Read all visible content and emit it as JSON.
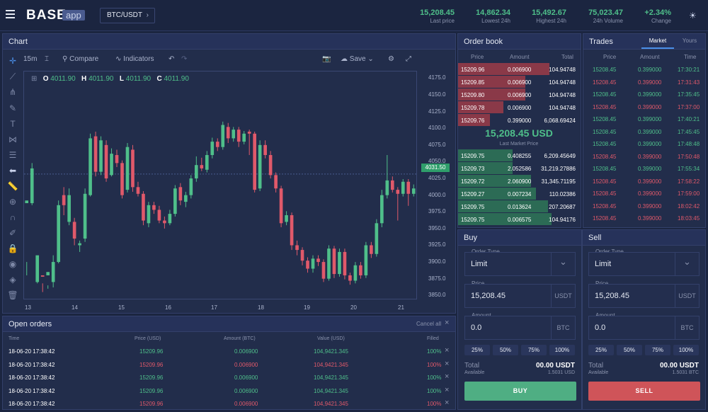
{
  "header": {
    "logo": "BASE",
    "logo_sub": "app",
    "pair": "BTC/USDT",
    "stats": [
      {
        "value": "15,208.45",
        "label": "Last price"
      },
      {
        "value": "14,862.34",
        "label": "Lowest 24h"
      },
      {
        "value": "15,492.67",
        "label": "Highest 24h"
      },
      {
        "value": "75,023.47",
        "label": "24h Volume"
      },
      {
        "value": "+2.34%",
        "label": "Change"
      }
    ]
  },
  "chart": {
    "title": "Chart",
    "interval": "15m",
    "compare": "Compare",
    "indicators": "Indicators",
    "save": "Save",
    "ohlc": {
      "o_label": "O",
      "o": "4011.90",
      "h_label": "H",
      "h": "4011.90",
      "l_label": "L",
      "l": "4011.90",
      "c_label": "C",
      "c": "4011.90"
    },
    "price_tag": "4031.50",
    "y_ticks": [
      "4175.0",
      "4150.0",
      "4125.0",
      "4100.0",
      "4075.0",
      "4050.0",
      "4025.0",
      "4000.0",
      "3975.0",
      "3950.0",
      "3925.0",
      "3900.0",
      "3875.0",
      "3850.0"
    ],
    "x_ticks": [
      "13",
      "14",
      "15",
      "16",
      "17",
      "18",
      "19",
      "20",
      "21"
    ]
  },
  "chart_data": {
    "type": "candlestick",
    "ylim": [
      3845,
      4185
    ],
    "last": 4031.5,
    "candles": [
      [
        3988,
        3992,
        3900,
        3880
      ],
      [
        3988,
        4040,
        3985,
        4048
      ],
      [
        3870,
        3910,
        3868,
        3872
      ],
      [
        3880,
        3878,
        3855,
        3868
      ],
      [
        3880,
        3885,
        3860,
        3865
      ],
      [
        3870,
        3900,
        3862,
        3910
      ],
      [
        3900,
        3985,
        3898,
        3992
      ],
      [
        4000,
        3985,
        3970,
        4012
      ],
      [
        3960,
        4000,
        3955,
        4010
      ],
      [
        3960,
        3935,
        3925,
        3966
      ],
      [
        3925,
        3928,
        3915,
        3932
      ],
      [
        3935,
        4002,
        3930,
        4010
      ],
      [
        4000,
        4085,
        3998,
        4092
      ],
      [
        4088,
        4035,
        4028,
        4095
      ],
      [
        4035,
        4082,
        4030,
        4088
      ],
      [
        4075,
        4025,
        4020,
        4082
      ],
      [
        4030,
        4062,
        4028,
        4070
      ],
      [
        4060,
        4048,
        4042,
        4068
      ],
      [
        4048,
        4000,
        3995,
        4052
      ],
      [
        4008,
        4072,
        4004,
        4078
      ],
      [
        4068,
        4012,
        4005,
        4075
      ],
      [
        4012,
        4002,
        3998,
        4020
      ],
      [
        4002,
        3962,
        3955,
        4006
      ],
      [
        3958,
        3985,
        3952,
        3990
      ],
      [
        3985,
        3978,
        3972,
        3990
      ],
      [
        3978,
        3962,
        3958,
        3984
      ],
      [
        3962,
        3958,
        3950,
        3968
      ],
      [
        3958,
        3972,
        3955,
        3978
      ],
      [
        3972,
        4010,
        3968,
        4015
      ],
      [
        4012,
        3992,
        3985,
        4018
      ],
      [
        3990,
        4000,
        3982,
        4005
      ],
      [
        4000,
        4025,
        3995,
        4030
      ],
      [
        4025,
        4045,
        4020,
        4058
      ],
      [
        4045,
        4040,
        4036,
        4056
      ],
      [
        4038,
        4060,
        4034,
        4066
      ],
      [
        4060,
        4080,
        4055,
        4086
      ],
      [
        4080,
        4072,
        4066,
        4085
      ],
      [
        4072,
        4105,
        4068,
        4110
      ],
      [
        4102,
        4085,
        4078,
        4108
      ],
      [
        4085,
        4098,
        4080,
        4102
      ],
      [
        4098,
        4080,
        4072,
        4102
      ],
      [
        4080,
        4092,
        4076,
        4096
      ],
      [
        4095,
        4092,
        4060,
        4098
      ],
      [
        4092,
        4008,
        4004,
        4095
      ],
      [
        4010,
        4075,
        4006,
        4082
      ],
      [
        4075,
        4060,
        4055,
        4082
      ],
      [
        4060,
        4030,
        4025,
        4066
      ],
      [
        4030,
        4010,
        4004,
        4034
      ],
      [
        4010,
        3958,
        3952,
        4014
      ],
      [
        3960,
        3970,
        3955,
        3976
      ],
      [
        3970,
        3925,
        3918,
        3974
      ],
      [
        3925,
        3918,
        3910,
        3932
      ],
      [
        3918,
        3902,
        3895,
        3922
      ],
      [
        3902,
        3890,
        3884,
        3907
      ],
      [
        3890,
        3905,
        3884,
        3910
      ],
      [
        3905,
        3900,
        3894,
        3910
      ],
      [
        3900,
        3875,
        3870,
        3904
      ],
      [
        3875,
        3920,
        3872,
        3925
      ],
      [
        3920,
        3882,
        3876,
        3924
      ],
      [
        3882,
        3915,
        3878,
        3920
      ],
      [
        3915,
        3880,
        3874,
        3920
      ],
      [
        3880,
        3872,
        3866,
        3884
      ],
      [
        3872,
        3895,
        3868,
        3900
      ],
      [
        3895,
        3880,
        3875,
        3900
      ],
      [
        3880,
        3925,
        3876,
        3930
      ],
      [
        3925,
        3912,
        3906,
        3930
      ],
      [
        3912,
        3958,
        3908,
        3964
      ],
      [
        3958,
        4000,
        3952,
        4008
      ],
      [
        4000,
        4022,
        3995,
        4060
      ],
      [
        4022,
        4008,
        4004,
        4028
      ],
      [
        4008,
        4002,
        3962,
        4012
      ],
      [
        4002,
        4020,
        3998,
        4024
      ],
      [
        4020,
        4002,
        3984,
        4024
      ],
      [
        4002,
        4010,
        3998,
        4016
      ]
    ]
  },
  "orderbook": {
    "title": "Order book",
    "headers": [
      "Price",
      "Amount",
      "Total"
    ],
    "asks": [
      {
        "p": "15209.96",
        "a": "0.006900",
        "t": "104.94748",
        "d": 0.75
      },
      {
        "p": "15209.85",
        "a": "0.006900",
        "t": "104.94748",
        "d": 0.55
      },
      {
        "p": "15209.80",
        "a": "0.006900",
        "t": "104.94748",
        "d": 0.55
      },
      {
        "p": "15209.78",
        "a": "0.006900",
        "t": "104.94748",
        "d": 0.37
      },
      {
        "p": "15209.76",
        "a": "0.399000",
        "t": "6,068.69424",
        "d": 0.26
      }
    ],
    "last": "15,208.45 USD",
    "last_label": "Last Market Price",
    "bids": [
      {
        "p": "15209.75",
        "a": "0.408255",
        "t": "6,209.45649",
        "d": 0.45
      },
      {
        "p": "15209.73",
        "a": "2.052586",
        "t": "31,219.27886",
        "d": 0.45
      },
      {
        "p": "15209.72",
        "a": "2.060900",
        "t": "31,345.71195",
        "d": 0.6
      },
      {
        "p": "15209.27",
        "a": "0.007234",
        "t": "110.02386",
        "d": 0.64
      },
      {
        "p": "15209.75",
        "a": "0.013624",
        "t": "207.20687",
        "d": 0.74
      },
      {
        "p": "15209.75",
        "a": "0.006575",
        "t": "104.94176",
        "d": 0.77
      }
    ]
  },
  "trades": {
    "title": "Trades",
    "tabs": [
      "Market",
      "Yours"
    ],
    "headers": [
      "Price",
      "Amount",
      "Time"
    ],
    "rows": [
      {
        "p": "15208.45",
        "a": "0.399000",
        "t": "17:30:21",
        "s": "g"
      },
      {
        "p": "15208.45",
        "a": "0.399000",
        "t": "17:31:43",
        "s": "r"
      },
      {
        "p": "15208.45",
        "a": "0.399000",
        "t": "17:35:45",
        "s": "g"
      },
      {
        "p": "15208.45",
        "a": "0.399000",
        "t": "17:37:00",
        "s": "r"
      },
      {
        "p": "15208.45",
        "a": "0.399000",
        "t": "17:40:21",
        "s": "g"
      },
      {
        "p": "15208.45",
        "a": "0.399000",
        "t": "17:45:45",
        "s": "g"
      },
      {
        "p": "15208.45",
        "a": "0.399000",
        "t": "17:48:48",
        "s": "g"
      },
      {
        "p": "15208.45",
        "a": "0.399000",
        "t": "17:50:48",
        "s": "r"
      },
      {
        "p": "15208.45",
        "a": "0.399000",
        "t": "17:55:34",
        "s": "g"
      },
      {
        "p": "15208.45",
        "a": "0.399000",
        "t": "17:58:22",
        "s": "r"
      },
      {
        "p": "15208.45",
        "a": "0.399000",
        "t": "17:59:00",
        "s": "r"
      },
      {
        "p": "15208.45",
        "a": "0.399000",
        "t": "18:02:42",
        "s": "r"
      },
      {
        "p": "15208.45",
        "a": "0.399000",
        "t": "18:03:45",
        "s": "r"
      }
    ]
  },
  "open_orders": {
    "title": "Open orders",
    "cancel_all": "Cancel all",
    "headers": [
      "Time",
      "Price (USD)",
      "Amount (BTC)",
      "Value (USD)",
      "Filled"
    ],
    "rows": [
      {
        "time": "18-06-20 17:38:42",
        "price": "15209.96",
        "amount": "0.006900",
        "value": "104,9421.345",
        "filled": "100%",
        "s": "g"
      },
      {
        "time": "18-06-20 17:38:42",
        "price": "15209.96",
        "amount": "0.006900",
        "value": "104,9421.345",
        "filled": "100%",
        "s": "r"
      },
      {
        "time": "18-06-20 17:38:42",
        "price": "15209.96",
        "amount": "0.006900",
        "value": "104,9421.345",
        "filled": "100%",
        "s": "g"
      },
      {
        "time": "18-06-20 17:38:42",
        "price": "15209.96",
        "amount": "0.006900",
        "value": "104,9421.345",
        "filled": "100%",
        "s": "g"
      },
      {
        "time": "18-06-20 17:38:42",
        "price": "15209.96",
        "amount": "0.006900",
        "value": "104,9421.345",
        "filled": "100%",
        "s": "r"
      }
    ]
  },
  "buy": {
    "title": "Buy",
    "order_type_label": "Order Type",
    "order_type": "Limit",
    "price_label": "Price",
    "price": "15,208.45",
    "price_unit": "USDT",
    "amount_label": "Amount",
    "amount": "0.0",
    "amount_unit": "BTC",
    "pcts": [
      "25%",
      "50%",
      "75%",
      "100%"
    ],
    "total_label": "Total",
    "total": "00.00 USDT",
    "avail_label": "Available",
    "avail": "1.5031 USD",
    "button": "BUY"
  },
  "sell": {
    "title": "Sell",
    "order_type_label": "Order Type",
    "order_type": "Limit",
    "price_label": "Price",
    "price": "15,208.45",
    "price_unit": "USDT",
    "amount_label": "Amount",
    "amount": "0.0",
    "amount_unit": "BTC",
    "pcts": [
      "25%",
      "50%",
      "75%",
      "100%"
    ],
    "total_label": "Total",
    "total": "00.00 USDT",
    "avail_label": "Available",
    "avail": "1.5031 BTC",
    "button": "SELL"
  },
  "colors": {
    "green": "#4fbf8a",
    "red": "#e0596a",
    "bg": "#1b2540",
    "panel": "#222d4b"
  }
}
